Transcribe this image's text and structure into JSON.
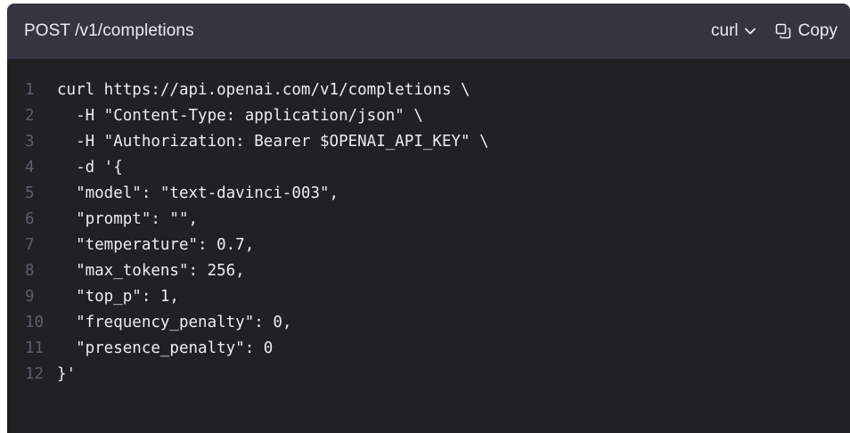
{
  "header": {
    "endpoint": "POST /v1/completions",
    "language_label": "curl",
    "copy_label": "Copy"
  },
  "code": {
    "lines": [
      {
        "num": "1",
        "text": "curl https://api.openai.com/v1/completions \\"
      },
      {
        "num": "2",
        "text": "  -H \"Content-Type: application/json\" \\"
      },
      {
        "num": "3",
        "text": "  -H \"Authorization: Bearer $OPENAI_API_KEY\" \\"
      },
      {
        "num": "4",
        "text": "  -d '{"
      },
      {
        "num": "5",
        "text": "  \"model\": \"text-davinci-003\","
      },
      {
        "num": "6",
        "text": "  \"prompt\": \"\","
      },
      {
        "num": "7",
        "text": "  \"temperature\": 0.7,"
      },
      {
        "num": "8",
        "text": "  \"max_tokens\": 256,"
      },
      {
        "num": "9",
        "text": "  \"top_p\": 1,"
      },
      {
        "num": "10",
        "text": "  \"frequency_penalty\": 0,"
      },
      {
        "num": "11",
        "text": "  \"presence_penalty\": 0"
      },
      {
        "num": "12",
        "text": "}'"
      }
    ]
  },
  "colors": {
    "header_bg": "#343541",
    "code_bg": "#202123",
    "text": "#ececf1",
    "line_number": "#5c5f6b"
  },
  "icons": {
    "language_dropdown": "chevron-down-icon",
    "copy": "copy-icon"
  }
}
